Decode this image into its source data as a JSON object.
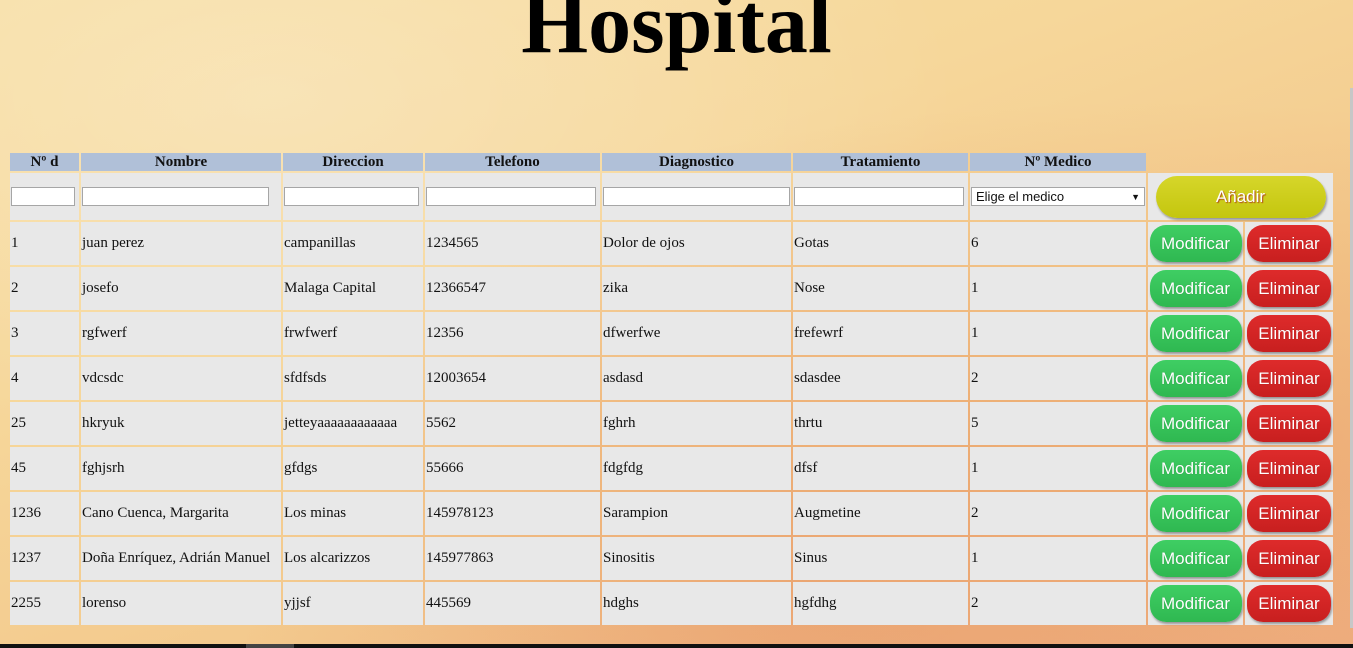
{
  "header": {
    "title": "Hospital"
  },
  "table": {
    "columns": [
      "Nº d",
      "Nombre",
      "Direccion",
      "Telefono",
      "Diagnostico",
      "Tratamiento",
      "Nº Medico"
    ],
    "inputs": {
      "select_value": "Elige el medico",
      "add_label": "Añadir"
    },
    "actions": {
      "modify_label": "Modificar",
      "delete_label": "Eliminar"
    },
    "rows": [
      [
        "1",
        "juan perez",
        "campanillas",
        "1234565",
        "Dolor de ojos",
        "Gotas",
        "6"
      ],
      [
        "2",
        "josefo",
        "Malaga Capital",
        "12366547",
        "zika",
        "Nose",
        "1"
      ],
      [
        "3",
        "rgfwerf",
        "frwfwerf",
        "12356",
        "dfwerfwe",
        "frefewrf",
        "1"
      ],
      [
        "4",
        "vdcsdc",
        "sfdfsds",
        "12003654",
        "asdasd",
        "sdasdee",
        "2"
      ],
      [
        "25",
        "hkryuk",
        "jetteyaaaaaaaaaaaa",
        "5562",
        "fghrh",
        "thrtu",
        "5"
      ],
      [
        "45",
        "fghjsrh",
        "gfdgs",
        "55666",
        "fdgfdg",
        "dfsf",
        "1"
      ],
      [
        "1236",
        "Cano Cuenca, Margarita",
        "Los minas",
        "145978123",
        "Sarampion",
        "Augmetine",
        "2"
      ],
      [
        "1237",
        "Doña Enríquez, Adrián Manuel",
        "Los alcarizzos",
        "145977863",
        "Sinositis",
        "Sinus",
        "1"
      ],
      [
        "2255",
        "lorenso",
        "yjjsf",
        "445569",
        "hdghs",
        "hgfdhg",
        "2"
      ]
    ]
  },
  "colors": {
    "header_bg": "#b0c0d8",
    "cell_bg": "#e8e8e8",
    "modify": "#3fce63",
    "delete": "#de2b2b",
    "add": "#d6d62a"
  }
}
